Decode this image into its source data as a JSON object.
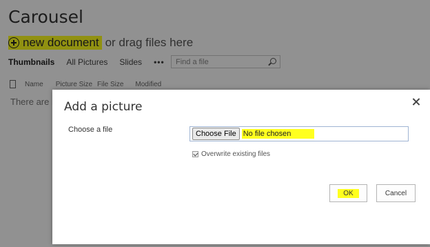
{
  "library": {
    "title": "Carousel",
    "new_document_label": "new document",
    "drag_text": "or drag files here"
  },
  "views": {
    "tabs": [
      "Thumbnails",
      "All Pictures",
      "Slides"
    ],
    "active_tab": "Thumbnails",
    "more_label": "•••",
    "search_placeholder": "Find a file"
  },
  "columns": [
    "Name",
    "Picture Size",
    "File Size",
    "Modified"
  ],
  "empty_text": "There are n",
  "dialog": {
    "title": "Add a picture",
    "choose_file_label": "Choose a file",
    "choose_file_button": "Choose File",
    "no_file_text": "No file chosen",
    "overwrite_label": "Overwrite existing files",
    "overwrite_checked": true,
    "ok_label": "OK",
    "cancel_label": "Cancel"
  },
  "colors": {
    "highlight": "#ffff1f",
    "overlay": "#8f8f8f"
  }
}
